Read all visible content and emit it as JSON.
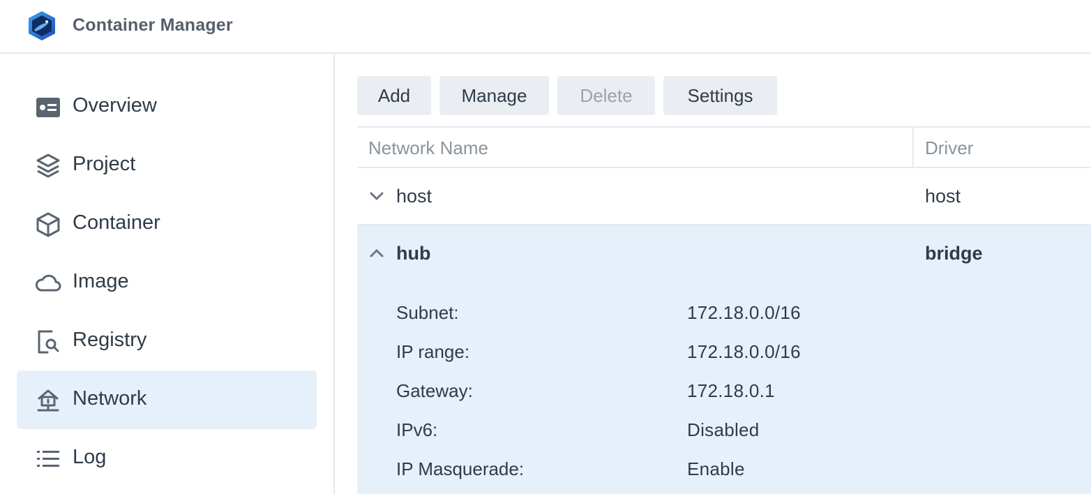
{
  "app": {
    "title": "Container Manager"
  },
  "sidebar": {
    "items": [
      {
        "label": "Overview",
        "icon": "overview-icon"
      },
      {
        "label": "Project",
        "icon": "layers-icon"
      },
      {
        "label": "Container",
        "icon": "cube-icon"
      },
      {
        "label": "Image",
        "icon": "cloud-icon"
      },
      {
        "label": "Registry",
        "icon": "registry-search-icon"
      },
      {
        "label": "Network",
        "icon": "network-icon",
        "active": true
      },
      {
        "label": "Log",
        "icon": "list-icon"
      }
    ]
  },
  "toolbar": {
    "add": "Add",
    "manage": "Manage",
    "delete": "Delete",
    "settings": "Settings"
  },
  "table": {
    "headers": {
      "name": "Network Name",
      "driver": "Driver"
    },
    "rows": [
      {
        "name": "host",
        "driver": "host",
        "expanded": false
      },
      {
        "name": "hub",
        "driver": "bridge",
        "expanded": true,
        "details": [
          {
            "label": "Subnet:",
            "value": "172.18.0.0/16"
          },
          {
            "label": "IP range:",
            "value": "172.18.0.0/16"
          },
          {
            "label": "Gateway:",
            "value": "172.18.0.1"
          },
          {
            "label": "IPv6:",
            "value": "Disabled"
          },
          {
            "label": "IP Masquerade:",
            "value": "Enable"
          }
        ]
      }
    ]
  },
  "colors": {
    "accent_bg": "#e6f0fa",
    "text": "#2f3b48",
    "muted": "#8a939c",
    "button_bg": "#eaeef2"
  }
}
